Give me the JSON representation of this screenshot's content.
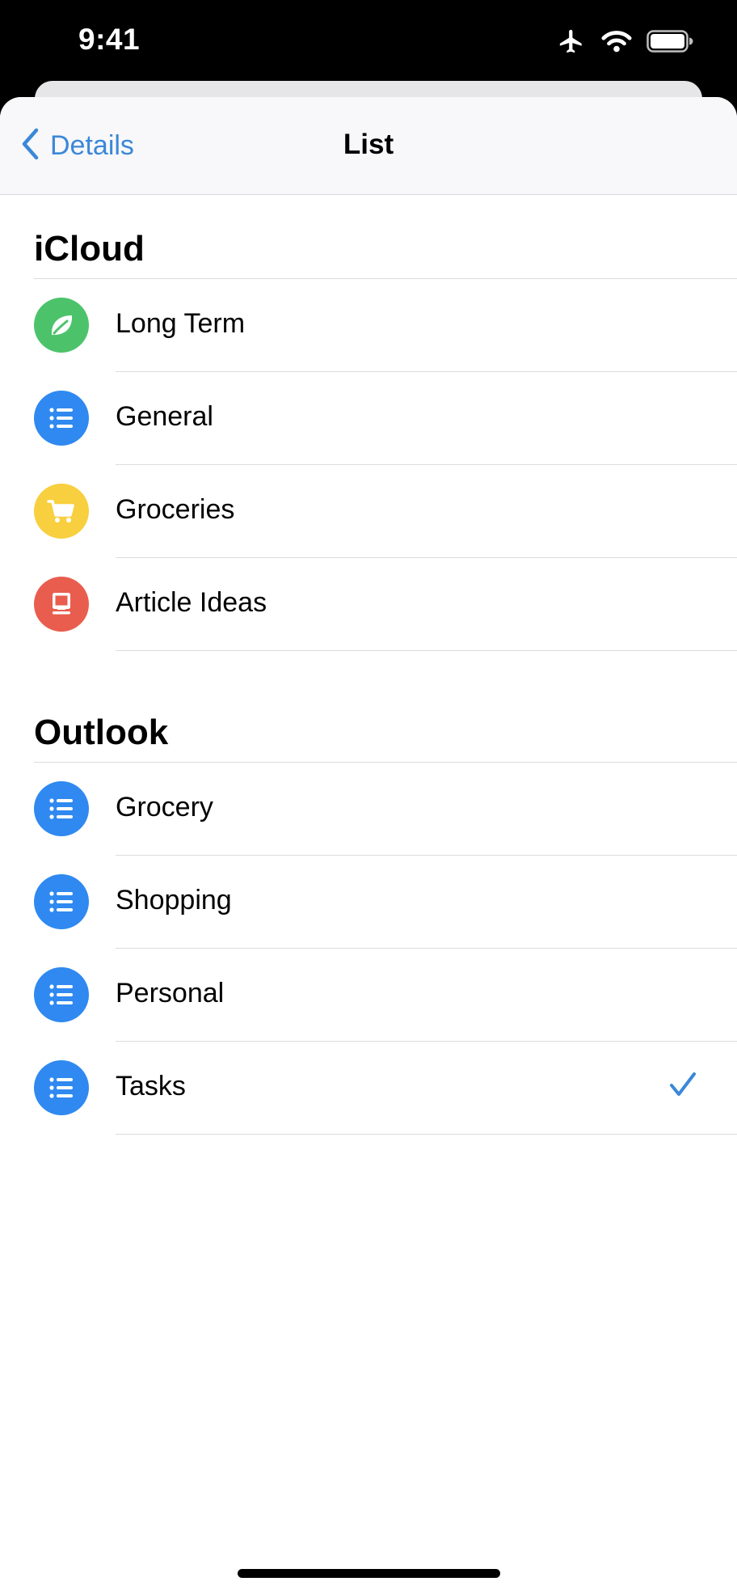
{
  "status_bar": {
    "time": "9:41",
    "icons": [
      "airplane-icon",
      "wifi-icon",
      "battery-icon"
    ]
  },
  "navbar": {
    "back_label": "Details",
    "title": "List",
    "accent_color": "#3a88d8"
  },
  "sections": [
    {
      "title": "iCloud",
      "items": [
        {
          "label": "Long Term",
          "icon": "leaf-icon",
          "color": "#4cc36b",
          "selected": false
        },
        {
          "label": "General",
          "icon": "list-bullet-icon",
          "color": "#2f89f0",
          "selected": false
        },
        {
          "label": "Groceries",
          "icon": "cart-icon",
          "color": "#f8cf3e",
          "selected": false
        },
        {
          "label": "Article Ideas",
          "icon": "desktop-icon",
          "color": "#e95d4e",
          "selected": false
        }
      ]
    },
    {
      "title": "Outlook",
      "items": [
        {
          "label": "Grocery",
          "icon": "list-bullet-icon",
          "color": "#2f89f0",
          "selected": false
        },
        {
          "label": "Shopping",
          "icon": "list-bullet-icon",
          "color": "#2f89f0",
          "selected": false
        },
        {
          "label": "Personal",
          "icon": "list-bullet-icon",
          "color": "#2f89f0",
          "selected": false
        },
        {
          "label": "Tasks",
          "icon": "list-bullet-icon",
          "color": "#2f89f0",
          "selected": true
        }
      ]
    }
  ]
}
